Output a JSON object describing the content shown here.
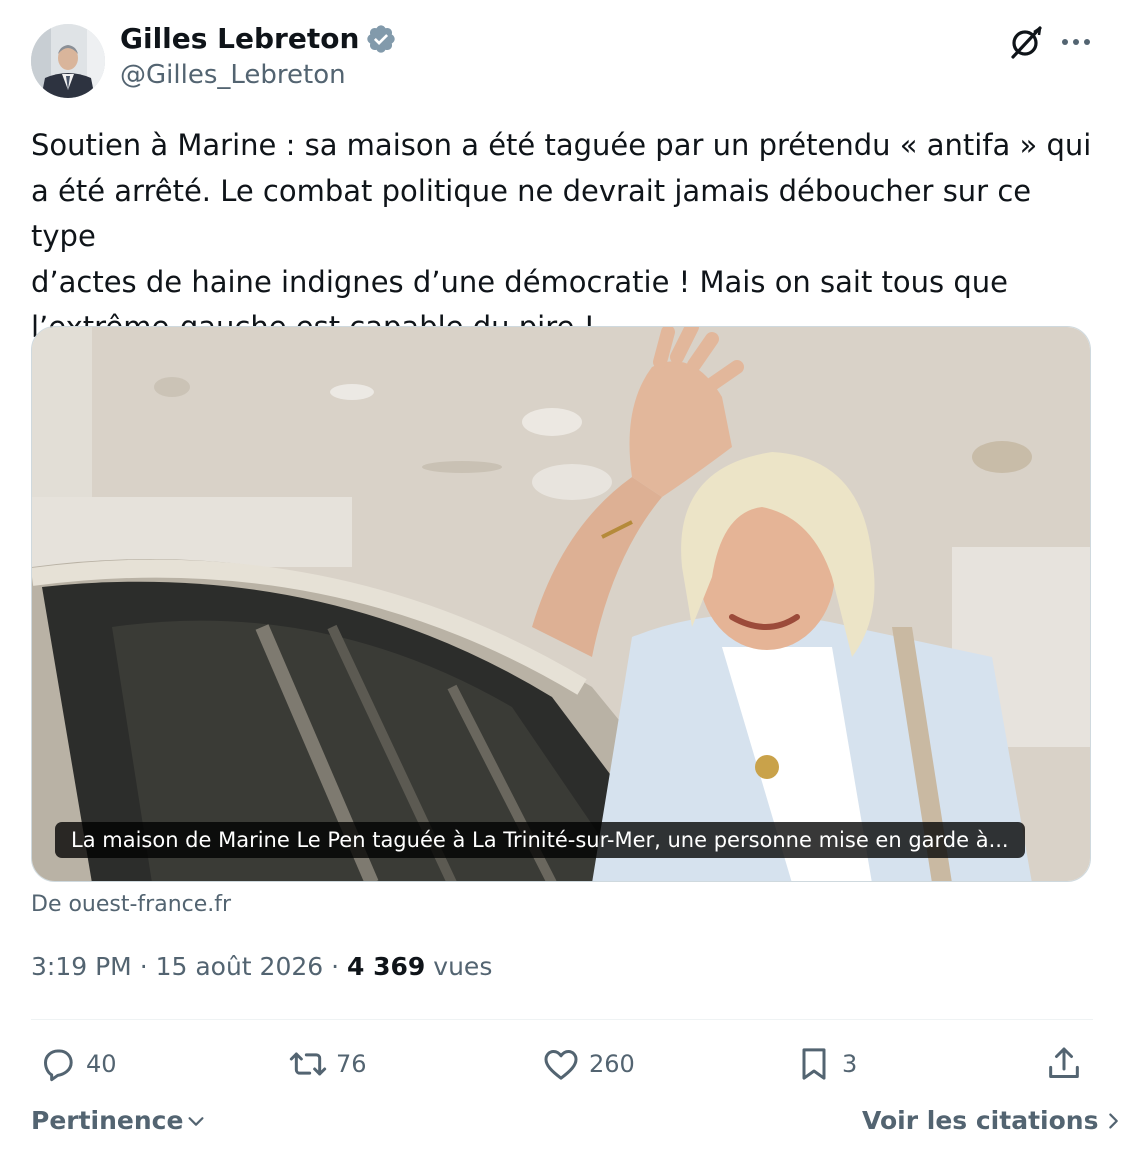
{
  "author": {
    "name": "Gilles Lebreton",
    "handle": "@Gilles_Lebreton",
    "verified_icon": "verified-badge-icon"
  },
  "tweet": {
    "text": "Soutien à Marine : sa maison a été taguée par un prétendu « antifa » qui\na été arrêté. Le combat politique ne devrait jamais déboucher sur ce type\nd’actes de haine indignes d’une démocratie ! Mais on sait tous que\nl’extrême-gauche est capable du pire !"
  },
  "card": {
    "caption": "La maison de Marine Le Pen taguée à La Trinité-sur-Mer, une personne mise en garde à...",
    "source": "De ouest-france.fr"
  },
  "meta": {
    "time": "3:19 PM",
    "separator": "·",
    "date": "15 août 2026",
    "views_count": "4 369",
    "views_label": "vues"
  },
  "actions": {
    "replies": "40",
    "reposts": "76",
    "likes": "260",
    "bookmarks": "3"
  },
  "footer": {
    "sort_label": "Pertinence",
    "quotes_label": "Voir les citations"
  },
  "colors": {
    "text_primary": "#0f1419",
    "text_secondary": "#536471",
    "verified": "#829aab",
    "divider": "#eff3f4"
  }
}
